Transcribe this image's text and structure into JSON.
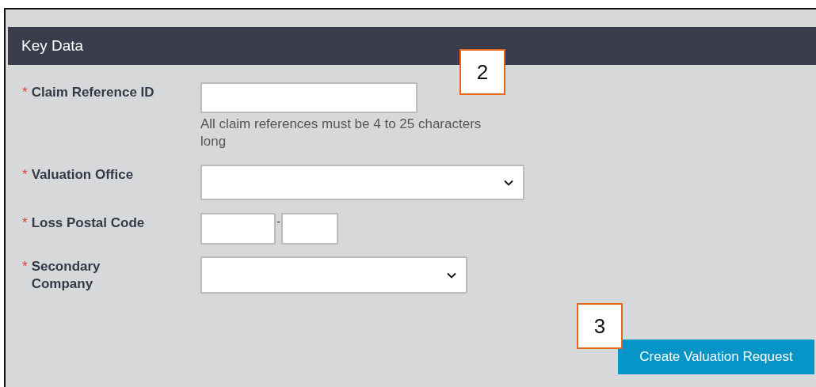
{
  "section": {
    "title": "Key Data"
  },
  "fields": [
    {
      "kind": "text",
      "label": "Claim Reference ID",
      "required": true,
      "required_mark": "*",
      "hint": "All claim references must be 4 to 25 characters long"
    },
    {
      "kind": "select",
      "label": "Valuation Office",
      "required": true,
      "required_mark": "*"
    },
    {
      "kind": "postal",
      "label": "Loss Postal Code",
      "required": true,
      "required_mark": "*",
      "separator": "-"
    },
    {
      "kind": "select-short",
      "label": "Secondary Company",
      "required": true,
      "required_mark": "*"
    }
  ],
  "button": {
    "label": "Create Valuation Request"
  },
  "callouts": [
    {
      "label": "2"
    },
    {
      "label": "3"
    }
  ]
}
